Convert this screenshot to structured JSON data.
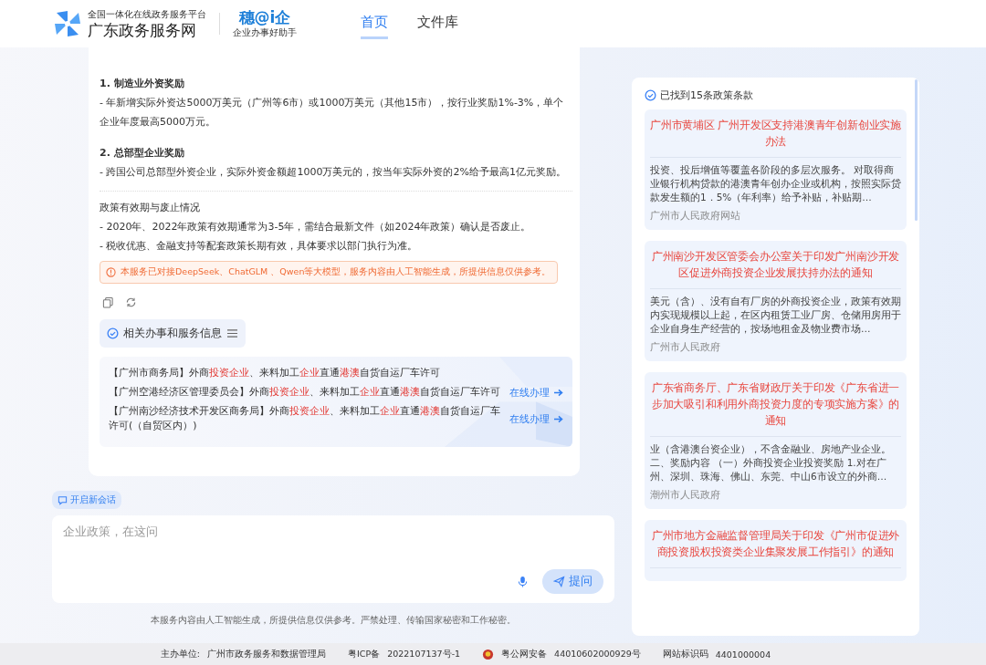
{
  "header": {
    "platform_subtitle": "全国一体化在线政务服务平台",
    "site_name": "广东政务服务网",
    "brand": {
      "name": "穗@i企",
      "tagline": "企业办事好助手"
    },
    "nav": [
      {
        "label": "首页",
        "selected": true
      },
      {
        "label": "文件库",
        "selected": false
      }
    ]
  },
  "answer": {
    "sections": [
      {
        "heading": "1. 制造业外资奖励",
        "kind": "bold",
        "lines": [
          "- 年新增实际外资达5000万美元（广州等6市）或1000万美元（其他15市），按行业奖励1%-3%，单个企业年度最高5000万元。"
        ]
      },
      {
        "heading": "2. 总部型企业奖励",
        "kind": "bold",
        "lines": [
          "- 跨国公司总部型外资企业，实际外资金额超1000万美元的，按当年实际外资的2%给予最高1亿元奖励。"
        ]
      },
      {
        "heading": "政策有效期与废止情况",
        "kind": "plain",
        "lines": [
          "- 2020年、2022年政策有效期通常为3-5年，需结合最新文件（如2024年政策）确认是否废止。",
          "- 税收优惠、金融支持等配套政策长期有效，具体要求以部门执行为准。"
        ]
      }
    ],
    "notice": "本服务已对接DeepSeek、ChatGLM 、Qwen等大模型，服务内容由人工智能生成，所提供信息仅供参考。",
    "related": {
      "title": "相关办事和服务信息",
      "items": [
        {
          "segments": [
            {
              "text": "【广州市商务局】外商",
              "highlight": false
            },
            {
              "text": "投资企业",
              "highlight": true
            },
            {
              "text": "、来料加工",
              "highlight": false
            },
            {
              "text": "企业",
              "highlight": true
            },
            {
              "text": "直通",
              "highlight": false
            },
            {
              "text": "港澳",
              "highlight": true
            },
            {
              "text": "自货自运厂车许可",
              "highlight": false
            }
          ]
        },
        {
          "segments": [
            {
              "text": "【广州空港经济区管理委员会】外商",
              "highlight": false
            },
            {
              "text": "投资企业",
              "highlight": true
            },
            {
              "text": "、来料加工",
              "highlight": false
            },
            {
              "text": "企业",
              "highlight": true
            },
            {
              "text": "直通",
              "highlight": false
            },
            {
              "text": "港澳",
              "highlight": true
            },
            {
              "text": "自货自运厂车许可",
              "highlight": false
            }
          ],
          "action": "在线办理"
        },
        {
          "segments": [
            {
              "text": "【广州南沙经济技术开发区商务局】外商",
              "highlight": false
            },
            {
              "text": "投资企业",
              "highlight": true
            },
            {
              "text": "、来料加工",
              "highlight": false
            },
            {
              "text": "企业",
              "highlight": true
            },
            {
              "text": "直通",
              "highlight": false
            },
            {
              "text": "港澳",
              "highlight": true
            },
            {
              "text": "自货自运厂车许可(（自贸区内）)",
              "highlight": false
            }
          ],
          "action": "在线办理"
        }
      ]
    }
  },
  "new_chat": "开启新会话",
  "input": {
    "placeholder": "企业政策，在这问",
    "ask_button": "提问"
  },
  "disclaimer": "本服务内容由人工智能生成，所提供信息仅供参考。严禁处理、传输国家秘密和工作秘密。",
  "results": {
    "found_label": "已找到15条政策条款",
    "policies": [
      {
        "title": "广州市黄埔区 广州开发区支持港澳青年创新创业实施办法",
        "excerpt": "投资、投后增值等覆盖各阶段的多层次服务。 对取得商业银行机构贷款的港澳青年创办企业或机构，按照实际贷款发生额的1．5%（年利率）给予补贴，补贴期…",
        "source": "广州市人民政府网站"
      },
      {
        "title": "广州南沙开发区管委会办公室关于印发广州南沙开发区促进外商投资企业发展扶持办法的通知",
        "excerpt": "美元（含）、没有自有厂房的外商投资企业，政策有效期内实现规模以上起，在区内租赁工业厂房、仓储用房用于企业自身生产经营的，按场地租金及物业费市场…",
        "source": "广州市人民政府"
      },
      {
        "title": "广东省商务厅、广东省财政厅关于印发《广东省进一步加大吸引和利用外商投资力度的专项实施方案》的通知",
        "excerpt": "业（含港澳台资企业），不含金融业、房地产业企业。二、奖励内容 （一）外商投资企业投资奖励 1.对在广州、深圳、珠海、佛山、东莞、中山6市设立的外商…",
        "source": "潮州市人民政府"
      },
      {
        "title": "广州市地方金融监督管理局关于印发《广州市促进外商投资股权投资类企业集聚发展工作指引》的通知"
      }
    ]
  },
  "footer": [
    {
      "label": "主办单位:",
      "value": "广州市政务服务和数据管理局"
    },
    {
      "label": "粤ICP备",
      "value": "2022107137号-1"
    },
    {
      "label": "粤公网安备",
      "value": "44010602000929号",
      "kind": "emblem"
    },
    {
      "label": "网站标识码",
      "value": "4401000004"
    }
  ]
}
